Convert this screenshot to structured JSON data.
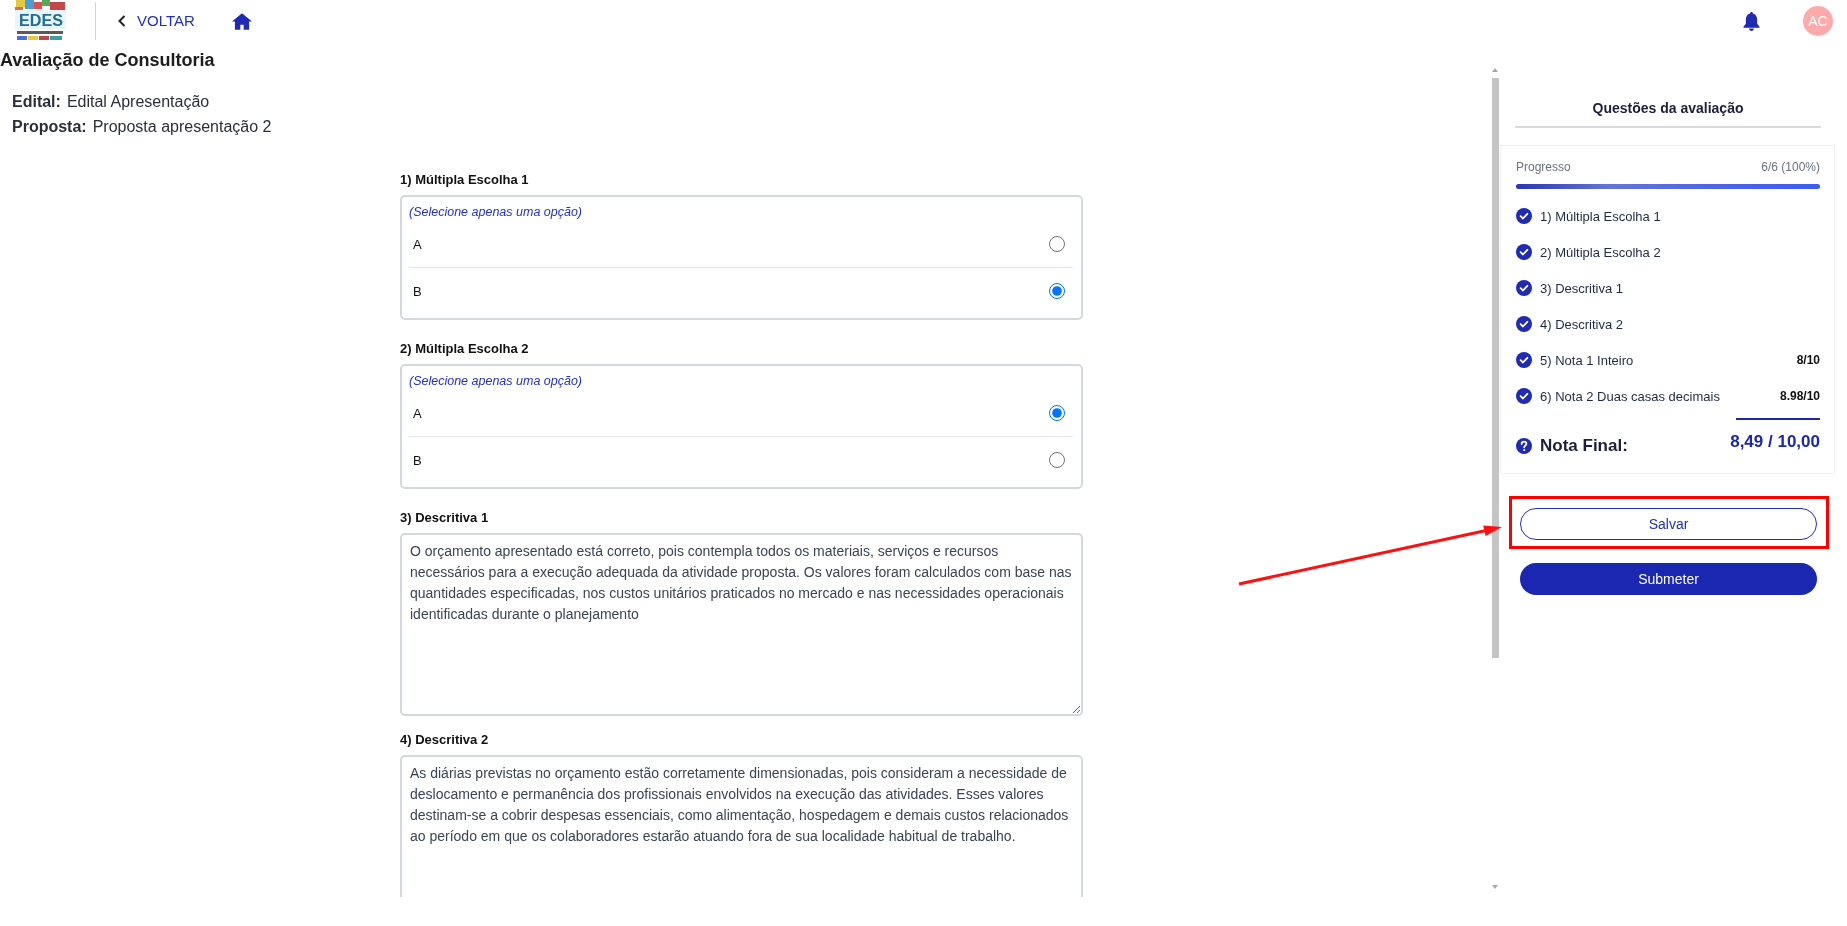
{
  "header": {
    "logo_text": "EDES",
    "back_link": "VOLTAR",
    "avatar_initials": "AC"
  },
  "page": {
    "title": "Avaliação de Consultoria",
    "details": [
      {
        "label": "Edital:",
        "value": "Edital Apresentação"
      },
      {
        "label": "Proposta:",
        "value": "Proposta apresentação 2"
      }
    ]
  },
  "questions": [
    {
      "kind": "choice",
      "title": "1) Múltipla Escolha 1",
      "hint": "(Selecione apenas uma opção)",
      "options": [
        {
          "label": "A",
          "selected": false
        },
        {
          "label": "B",
          "selected": true
        }
      ]
    },
    {
      "kind": "choice",
      "title": "2) Múltipla Escolha 2",
      "hint": "(Selecione apenas uma opção)",
      "options": [
        {
          "label": "A",
          "selected": true
        },
        {
          "label": "B",
          "selected": false
        }
      ]
    },
    {
      "kind": "text",
      "title": "3) Descritiva 1",
      "answer": "O orçamento apresentado está correto, pois contempla todos os materiais, serviços e recursos necessários para a execução adequada da atividade proposta. Os valores foram calculados com base nas quantidades especificadas, nos custos unitários praticados no mercado e nas necessidades operacionais identificadas durante o planejamento"
    },
    {
      "kind": "text",
      "title": "4) Descritiva 2",
      "answer": "As diárias previstas no orçamento estão corretamente dimensionadas, pois consideram a necessidade de deslocamento e permanência dos profissionais envolvidos na execução das atividades. Esses valores destinam-se a cobrir despesas essenciais, como alimentação, hospedagem e demais custos relacionados ao período em que os colaboradores estarão atuando fora de sua localidade habitual de trabalho."
    }
  ],
  "sidebar": {
    "title": "Questões da avaliação",
    "progress": {
      "label": "Progresso",
      "reading": "6/6 (100%)",
      "level": 1
    },
    "items": [
      {
        "label": "1) Múltipla Escolha 1",
        "answered": true
      },
      {
        "label": "2) Múltipla Escolha 2",
        "answered": true
      },
      {
        "label": "3) Descritiva 1",
        "answered": true
      },
      {
        "label": "4) Descritiva 2",
        "answered": true
      },
      {
        "label": "5) Nota 1 Inteiro",
        "answered": true,
        "score": "8/10"
      },
      {
        "label": "6) Nota 2 Duas casas decimais",
        "answered": true,
        "score": "8.98/10"
      }
    ],
    "final": {
      "label": "Nota Final:",
      "score": "8,49 / 10,00"
    }
  },
  "buttons": [
    {
      "label": "Salvar",
      "kind": "outline",
      "highlighted": true
    },
    {
      "label": "Submeter",
      "kind": "primary",
      "highlighted": false
    }
  ]
}
